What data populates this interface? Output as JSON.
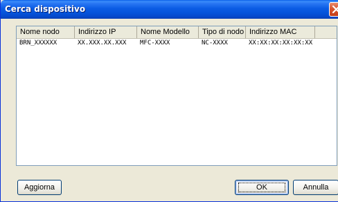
{
  "window": {
    "title": "Cerca dispositivo"
  },
  "table": {
    "columns": [
      "Nome nodo",
      "Indirizzo IP",
      "Nome Modello",
      "Tipo di nodo",
      "Indirizzo MAC"
    ],
    "rows": [
      [
        "BRN_XXXXXX",
        "XX.XXX.XX.XXX",
        "MFC-XXXX",
        "NC-XXXX",
        "XX:XX:XX:XX:XX:XX"
      ]
    ]
  },
  "buttons": {
    "refresh_label": "Aggiorna",
    "ok_label": "OK",
    "cancel_label": "Annulla"
  },
  "icons": {
    "close": "close-icon"
  },
  "colors": {
    "title_bar": "#0b5ce4",
    "close_button": "#d8542f",
    "dialog_background": "#ece9d8"
  }
}
